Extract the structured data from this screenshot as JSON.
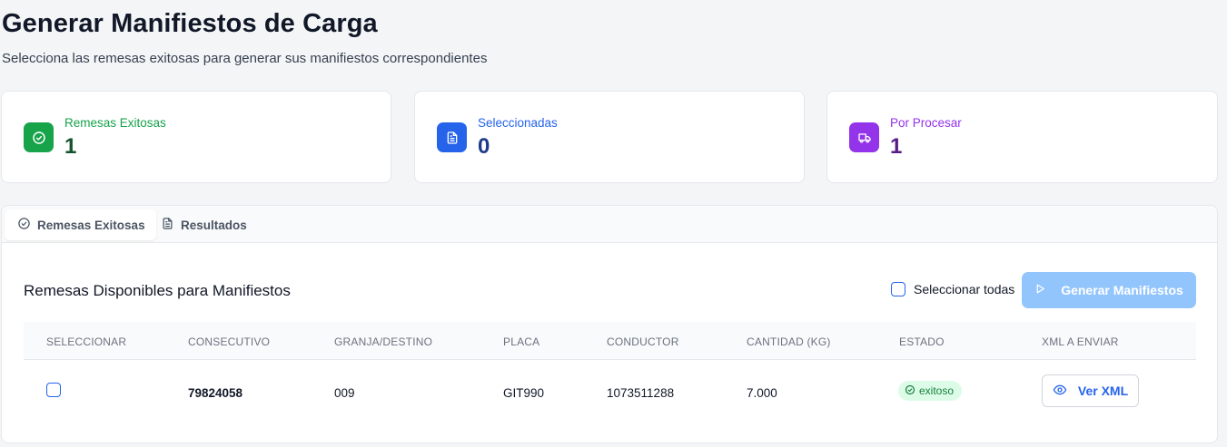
{
  "header": {
    "title": "Generar Manifiestos de Carga",
    "subtitle": "Selecciona las remesas exitosas para generar sus manifiestos correspondientes"
  },
  "stats": [
    {
      "label": "Remesas Exitosas",
      "value": "1",
      "icon": "check-circle-icon",
      "color": "#16a34a",
      "value_color": "#14532d"
    },
    {
      "label": "Seleccionadas",
      "value": "0",
      "icon": "file-text-icon",
      "color": "#2563eb",
      "value_color": "#1e3a8a"
    },
    {
      "label": "Por Procesar",
      "value": "1",
      "icon": "truck-icon",
      "color": "#9333ea",
      "value_color": "#581c87"
    }
  ],
  "tabs": [
    {
      "label": "Remesas Exitosas",
      "icon": "check-circle-icon",
      "active": true
    },
    {
      "label": "Resultados",
      "icon": "file-text-icon",
      "active": false
    }
  ],
  "section": {
    "title": "Remesas Disponibles para Manifiestos",
    "select_all_label": "Seleccionar todas",
    "generate_label": "Generar Manifiestos"
  },
  "table": {
    "headers": [
      "Seleccionar",
      "Consecutivo",
      "Granja/Destino",
      "Placa",
      "Conductor",
      "Cantidad (kg)",
      "Estado",
      "XML a Enviar"
    ],
    "rows": [
      {
        "consecutivo": "79824058",
        "granja": "009",
        "placa": "GIT990",
        "conductor": "1073511288",
        "cantidad": "7.000",
        "estado": "exitoso",
        "xml_label": "Ver XML"
      }
    ]
  },
  "colors": {
    "accent": "#2563eb",
    "success": "#16a34a",
    "purple": "#9333ea",
    "disabled_button": "#93c5fd"
  }
}
